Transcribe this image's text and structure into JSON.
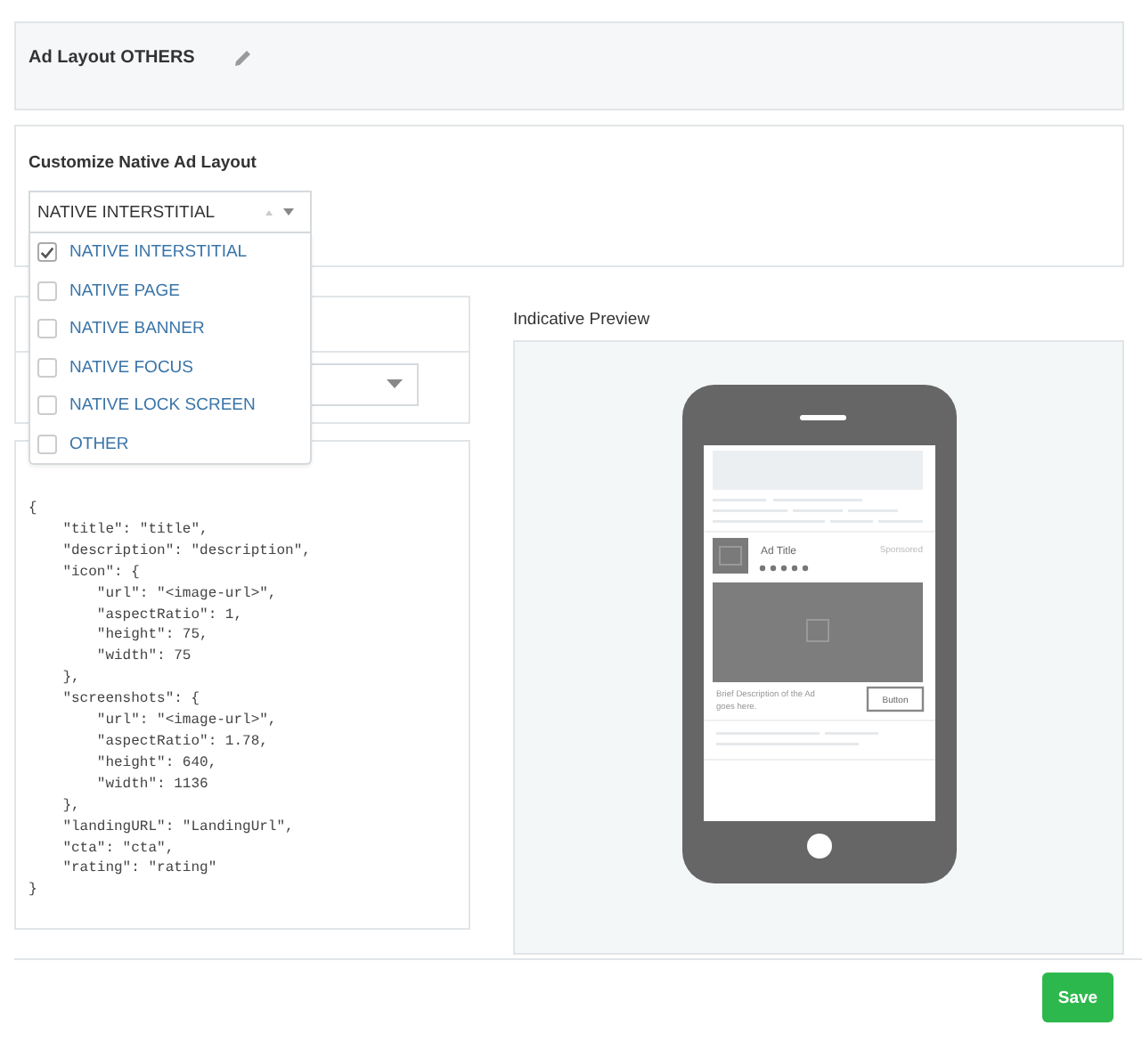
{
  "header": {
    "title": "Ad Layout OTHERS"
  },
  "customize": {
    "label": "Customize Native Ad Layout",
    "select": {
      "value": "NATIVE INTERSTITIAL",
      "expanded": true
    },
    "options": [
      {
        "label": "NATIVE INTERSTITIAL",
        "checked": true
      },
      {
        "label": "NATIVE PAGE",
        "checked": false
      },
      {
        "label": "NATIVE BANNER",
        "checked": false
      },
      {
        "label": "NATIVE FOCUS",
        "checked": false
      },
      {
        "label": "NATIVE LOCK SCREEN",
        "checked": false
      },
      {
        "label": "OTHER",
        "checked": false
      }
    ]
  },
  "code": [
    "{",
    "    \"title\": \"title\",",
    "    \"description\": \"description\",",
    "    \"icon\": {",
    "        \"url\": \"<image-url>\",",
    "        \"aspectRatio\": 1,",
    "        \"height\": 75,",
    "        \"width\": 75",
    "    },",
    "    \"screenshots\": {",
    "        \"url\": \"<image-url>\",",
    "        \"aspectRatio\": 1.78,",
    "        \"height\": 640,",
    "        \"width\": 1136",
    "    },",
    "    \"landingURL\": \"LandingUrl\",",
    "    \"cta\": \"cta\",",
    "    \"rating\": \"rating\"",
    "}"
  ],
  "preview": {
    "title": "Indicative Preview",
    "ad": {
      "title": "Ad Title",
      "sponsored": "Sponsored",
      "stars": 5,
      "description_lines": [
        "Brief Description of the Ad",
        "goes here."
      ],
      "button": "Button"
    }
  },
  "save": "Save"
}
